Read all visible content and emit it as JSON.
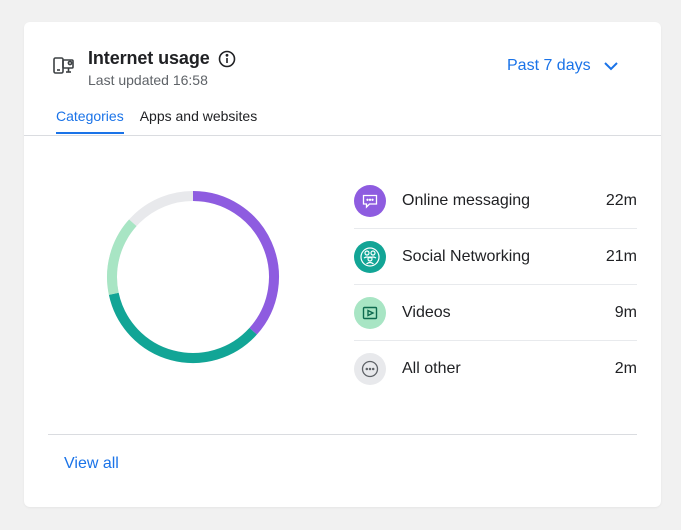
{
  "header": {
    "title": "Internet usage",
    "subtitle": "Last updated 16:58",
    "range_label": "Past 7 days",
    "device_icon": "device-icon",
    "info_icon": "info-icon",
    "range_icon": "chevron-down-icon"
  },
  "tabs": [
    {
      "label": "Categories",
      "active": true
    },
    {
      "label": "Apps and websites",
      "active": false
    }
  ],
  "categories": [
    {
      "label": "Online messaging",
      "value": "22m",
      "minutes": 22,
      "color": "#8e5ce0",
      "icon": "chat-bubble-icon"
    },
    {
      "label": "Social Networking",
      "value": "21m",
      "minutes": 21,
      "color": "#12a596",
      "icon": "people-icon"
    },
    {
      "label": "Videos",
      "value": "9m",
      "minutes": 9,
      "color": "#a8e5c4",
      "icon": "play-video-icon"
    },
    {
      "label": "All other",
      "value": "2m",
      "minutes": 2,
      "color": "#e8e9ec",
      "icon": "more-dots-icon"
    }
  ],
  "footer": {
    "view_all": "View all"
  },
  "colors": {
    "accent": "#1a73e8",
    "donut_track": "#e8e9ec"
  }
}
